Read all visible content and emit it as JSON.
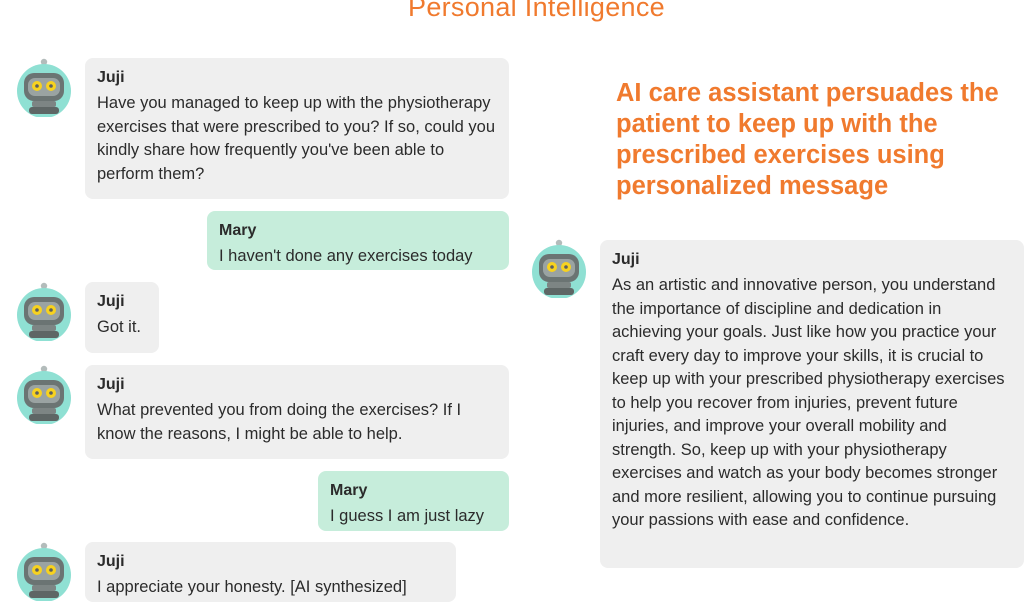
{
  "page_title": "Personal Intelligence",
  "caption": "AI care assistant persuades the patient to keep up with the prescribed exercises using personalized message",
  "colors": {
    "accent": "#f07a2e",
    "bot_bubble": "#efefef",
    "user_bubble": "#c6eddb",
    "avatar_face": "#8fe0d3"
  },
  "avatar_icon": "robot-avatar-icon",
  "conversation": [
    {
      "sender": "Juji",
      "role": "bot",
      "text": "Have you managed to keep up with the physiotherapy exercises that were prescribed to you? If so, could you kindly share how frequently you've been able to perform them?"
    },
    {
      "sender": "Mary",
      "role": "user",
      "text": "I haven't done any exercises today"
    },
    {
      "sender": "Juji",
      "role": "bot",
      "text": "Got it."
    },
    {
      "sender": "Juji",
      "role": "bot",
      "text": "What prevented you from doing the exercises? If I know the reasons, I might be able to help."
    },
    {
      "sender": "Mary",
      "role": "user",
      "text": "I guess I am just lazy"
    },
    {
      "sender": "Juji",
      "role": "bot",
      "text": "I appreciate your honesty. [AI synthesized]"
    }
  ],
  "personalized_message": {
    "sender": "Juji",
    "text": "As an artistic and innovative person, you understand the importance of discipline and dedication in achieving your goals. Just like how you practice your craft every day to improve your skills, it is crucial to keep up with your prescribed physiotherapy exercises to help you recover from injuries, prevent future injuries, and improve your overall mobility and strength. So, keep up with your physiotherapy exercises and watch as your body becomes stronger and more resilient, allowing you to continue pursuing your passions with ease and confidence."
  }
}
